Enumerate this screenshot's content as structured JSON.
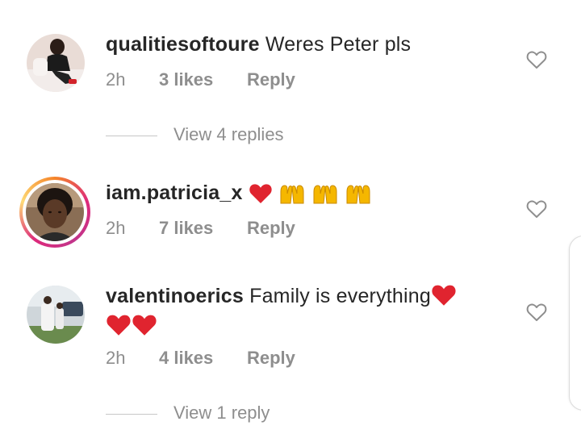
{
  "comments": [
    {
      "username": "qualitiesoftoure",
      "text": "Weres Peter pls",
      "time": "2h",
      "likes": "3 likes",
      "reply": "Reply",
      "view_replies": "View 4 replies"
    },
    {
      "username": "iam.patricia_x",
      "text": "",
      "emojis": [
        "red-heart",
        "raising-hands",
        "raising-hands",
        "raising-hands"
      ],
      "time": "2h",
      "likes": "7 likes",
      "reply": "Reply",
      "has_story_ring": true
    },
    {
      "username": "valentinoerics",
      "text": "Family is everything",
      "emojis": [
        "red-heart",
        "red-heart",
        "red-heart"
      ],
      "time": "2h",
      "likes": "4 likes",
      "reply": "Reply",
      "view_replies": "View 1 reply"
    }
  ],
  "icons": {
    "like": "heart-outline-icon"
  },
  "colors": {
    "text": "#262626",
    "secondary": "#8e8e8e",
    "heart": "#e0242f",
    "clap": "#f5b700"
  }
}
